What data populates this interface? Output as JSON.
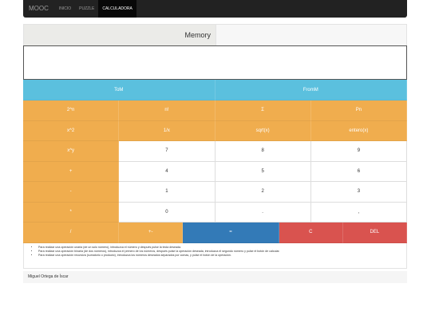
{
  "nav": {
    "brand": "MOOC",
    "links": [
      "INICIO",
      "PUZZLE",
      "CALCULADORA"
    ]
  },
  "memory": {
    "label": "Memory"
  },
  "display": {
    "value": ""
  },
  "memory_buttons": [
    "ToM",
    "FromM"
  ],
  "keys": {
    "row1": [
      "2^n",
      "n!",
      "Σ",
      "Pn"
    ],
    "row2": [
      "x^2",
      "1/x",
      "sqrt(x)",
      "entero(x)"
    ],
    "row3": [
      "x^y",
      "7",
      "8",
      "9"
    ],
    "row4": [
      "+",
      "4",
      "5",
      "6"
    ],
    "row5": [
      "-",
      "1",
      "2",
      "3"
    ],
    "row6": [
      "*",
      "0",
      ".",
      ","
    ],
    "row7": [
      "/",
      "+-",
      "=",
      "C",
      "DEL"
    ]
  },
  "help": [
    "Para realizar una operación unaria (de un solo número), introduzca el número y después pulse la tecla deseada.",
    "Para realizar una operación binaria (de dos números), introduzca el primero de los números, después pulse la operación deseada, introduzca el segundo número y pulse el botón de calcular.",
    "Para realizar una operación recursiva (sumatorio o producto), introduzca los números deseados separados por comas, y pulse el botón de la operación."
  ],
  "footer": {
    "author": "Miguel Ortega de Íscar"
  },
  "colors": {
    "info": "#5bc0de",
    "warning": "#f0ad4e",
    "primary": "#337ab7",
    "danger": "#d9534f",
    "navbar": "#222222"
  }
}
